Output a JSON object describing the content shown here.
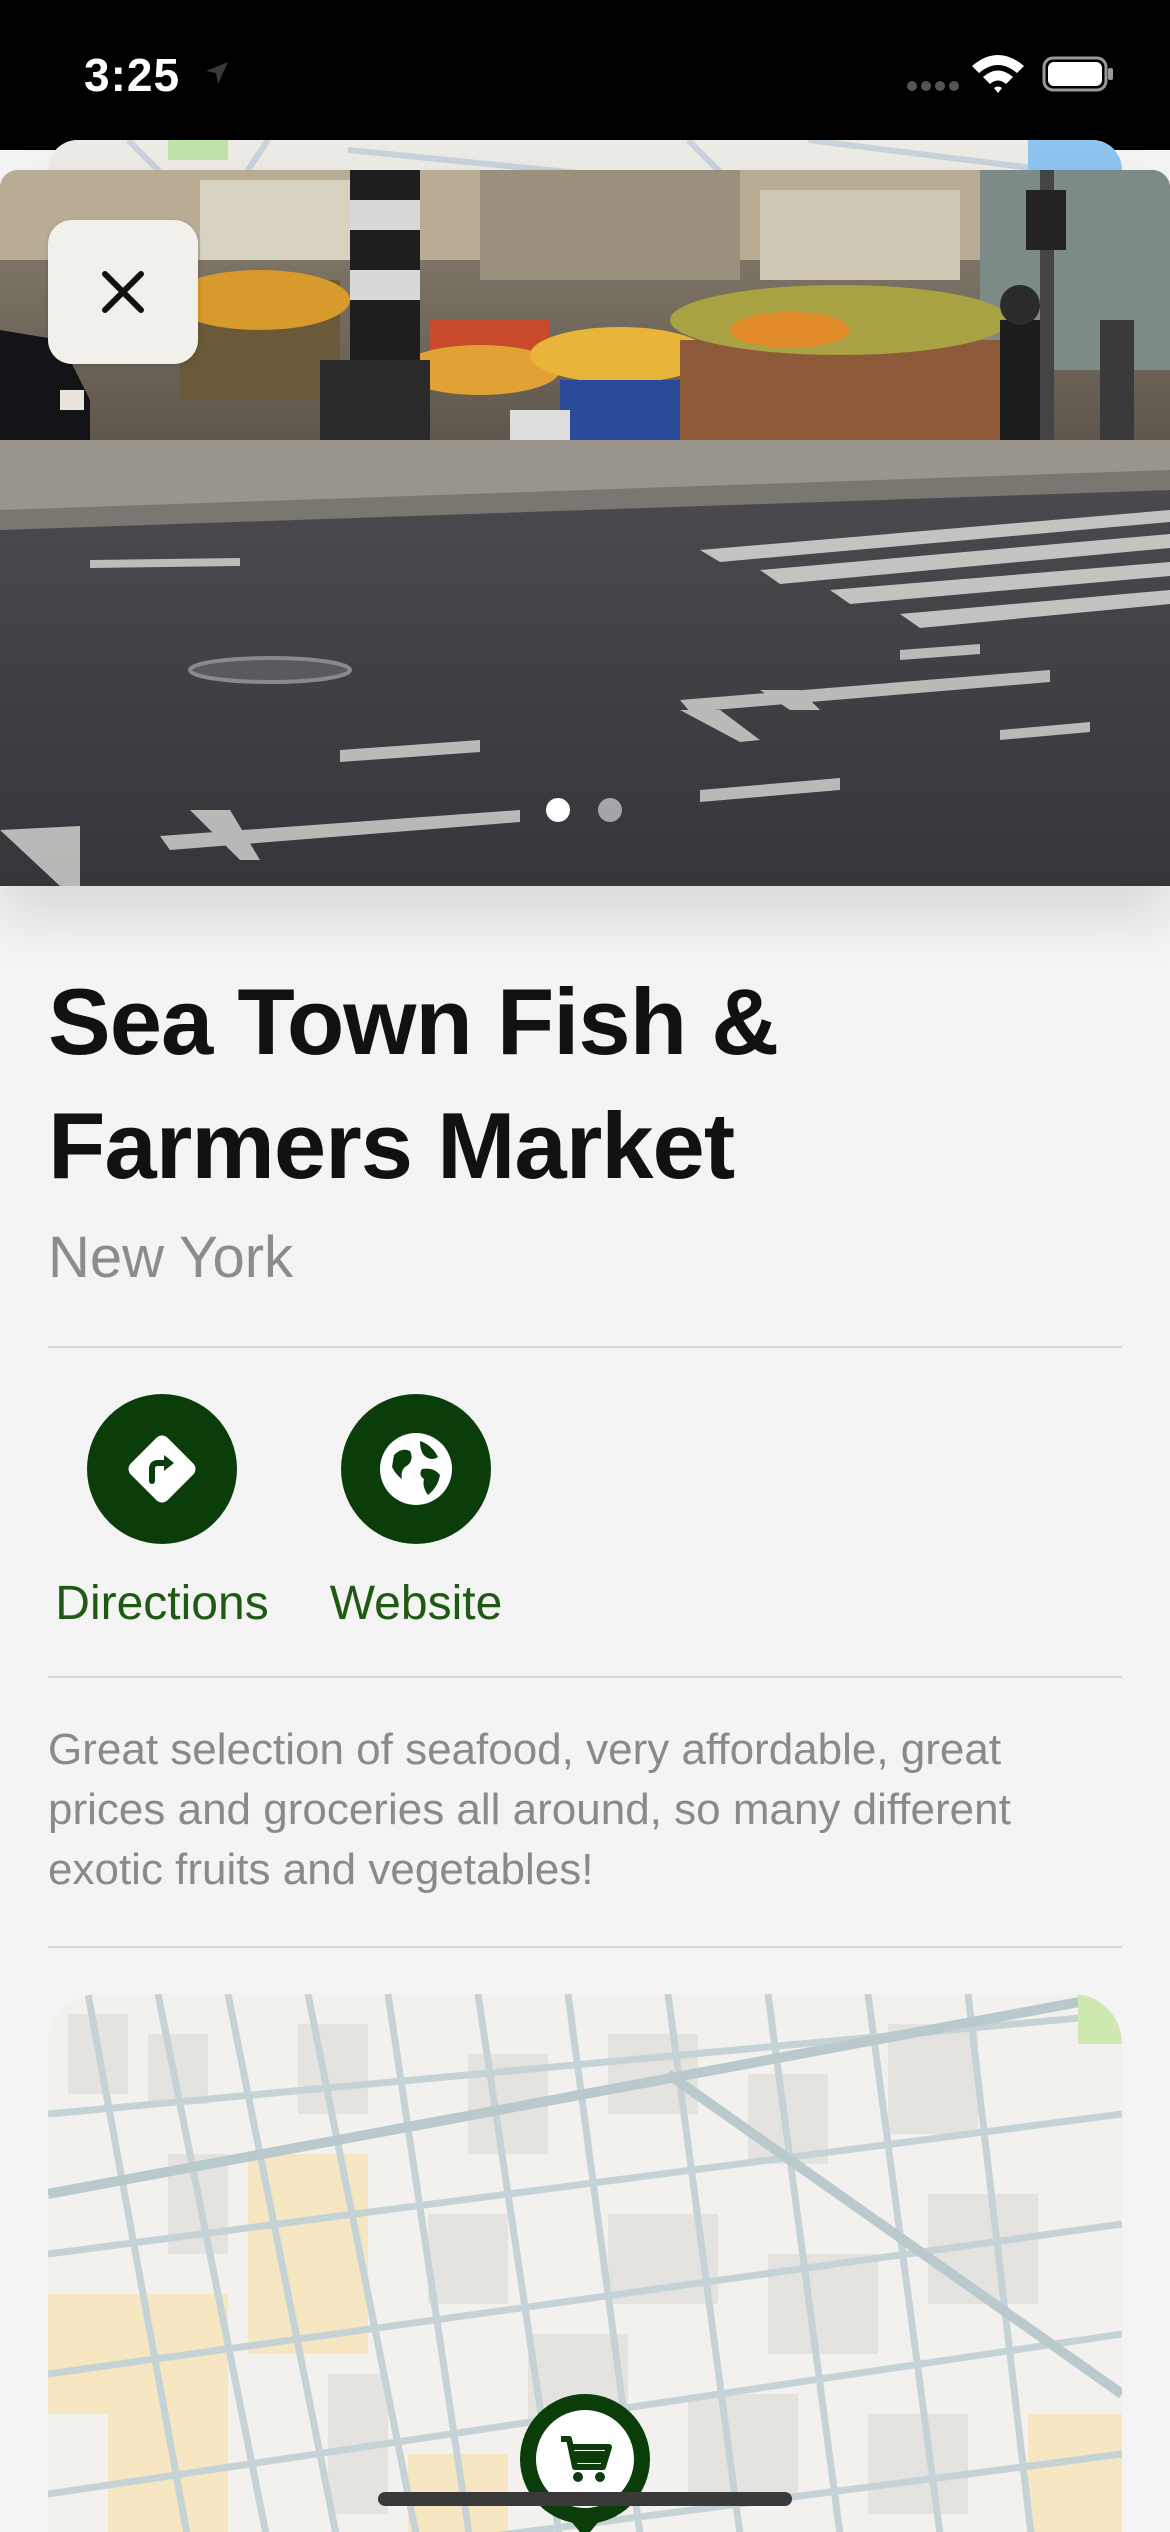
{
  "status_bar": {
    "time": "3:25"
  },
  "place": {
    "title": "Sea Town Fish & Farmers Market",
    "city": "New York",
    "description": "Great selection of seafood, very affordable, great prices and groceries all around, so many different exotic fruits and vegetables!"
  },
  "photo_pager": {
    "current_page": 1,
    "total_pages": 2
  },
  "actions": {
    "directions_label": "Directions",
    "website_label": "Website"
  },
  "icons": {
    "close": "close-icon",
    "directions": "directions-icon",
    "website": "globe-icon",
    "map_pin": "cart-icon"
  },
  "colors": {
    "accent": "#0b3d0b",
    "accent_text": "#1f5a14",
    "secondary_text": "#8c8c8c",
    "background": "#f4f4f4"
  }
}
